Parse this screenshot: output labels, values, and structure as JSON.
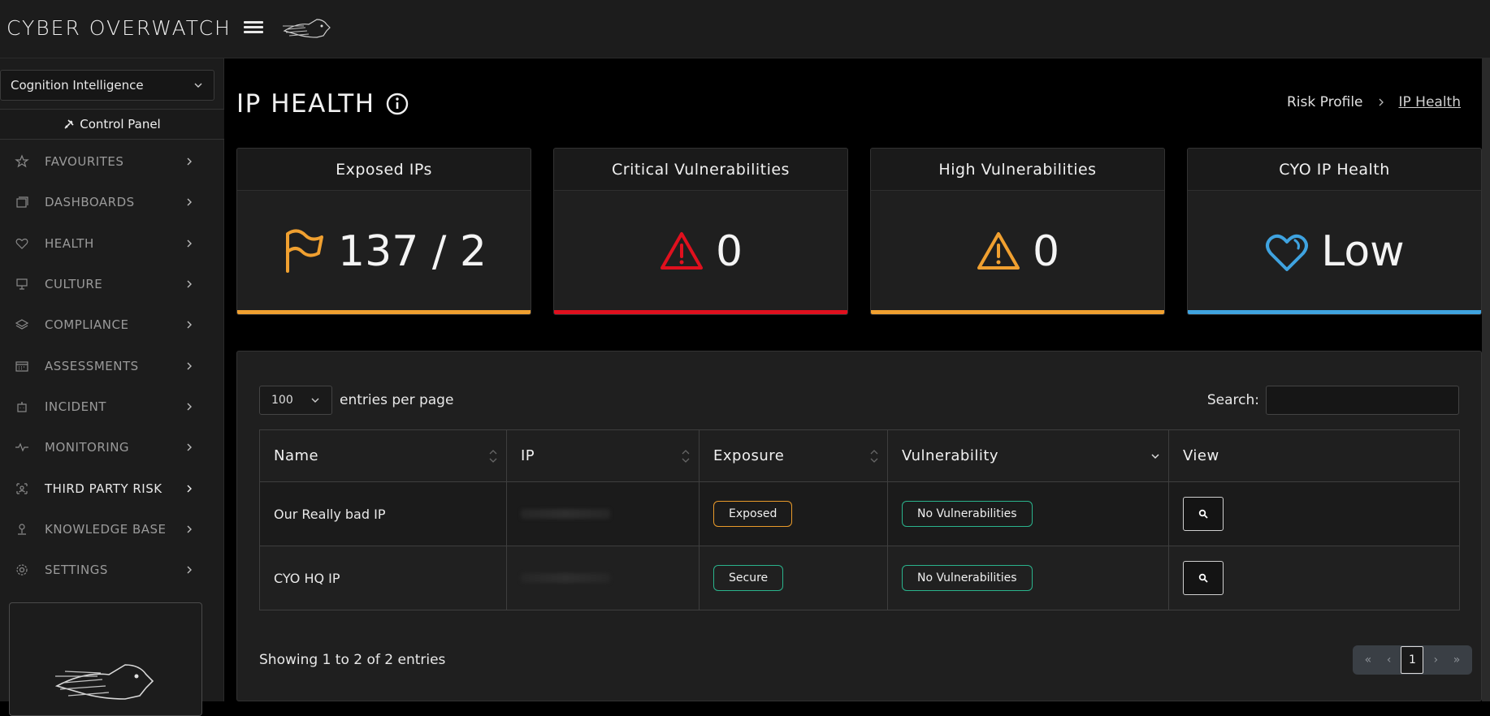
{
  "app": {
    "logo_text": "CYBER OVERWATCH"
  },
  "sidebar": {
    "org_select": "Cognition Intelligence",
    "control_panel_label": "Control Panel",
    "items": [
      {
        "label": "FAVOURITES",
        "icon": "star-icon"
      },
      {
        "label": "DASHBOARDS",
        "icon": "dashboards-icon"
      },
      {
        "label": "HEALTH",
        "icon": "heart-icon"
      },
      {
        "label": "CULTURE",
        "icon": "presentation-icon"
      },
      {
        "label": "COMPLIANCE",
        "icon": "layers-icon"
      },
      {
        "label": "ASSESSMENTS",
        "icon": "calendar-icon"
      },
      {
        "label": "INCIDENT",
        "icon": "robot-icon"
      },
      {
        "label": "MONITORING",
        "icon": "activity-icon"
      },
      {
        "label": "THIRD PARTY RISK",
        "icon": "vendor-icon"
      },
      {
        "label": "KNOWLEDGE BASE",
        "icon": "pin-icon"
      },
      {
        "label": "SETTINGS",
        "icon": "gear-icon"
      }
    ]
  },
  "page": {
    "title": "IP HEALTH",
    "breadcrumb": {
      "parent": "Risk Profile",
      "current": "IP Health"
    }
  },
  "cards": [
    {
      "title": "Exposed IPs",
      "value": "137 / 2",
      "icon": "flag-icon",
      "color": "#f0a030"
    },
    {
      "title": "Critical Vulnerabilities",
      "value": "0",
      "icon": "warning-icon",
      "color": "#e0101e"
    },
    {
      "title": "High Vulnerabilities",
      "value": "0",
      "icon": "warning-icon",
      "color": "#f0a030"
    },
    {
      "title": "CYO IP Health",
      "value": "Low",
      "icon": "heart-icon",
      "color": "#3fa3e0"
    }
  ],
  "table": {
    "entries_per_page": "100",
    "entries_label": "entries per page",
    "search_label": "Search:",
    "columns": [
      "Name",
      "IP",
      "Exposure",
      "Vulnerability",
      "View"
    ],
    "rows": [
      {
        "name": "Our Really bad IP",
        "exposure": "Exposed",
        "vulnerability": "No Vulnerabilities"
      },
      {
        "name": "CYO HQ IP",
        "exposure": "Secure",
        "vulnerability": "No Vulnerabilities"
      }
    ],
    "showing": "Showing 1 to 2 of 2 entries",
    "pagination": {
      "first": "«",
      "prev": "‹",
      "current": "1",
      "next": "›",
      "last": "»"
    }
  }
}
